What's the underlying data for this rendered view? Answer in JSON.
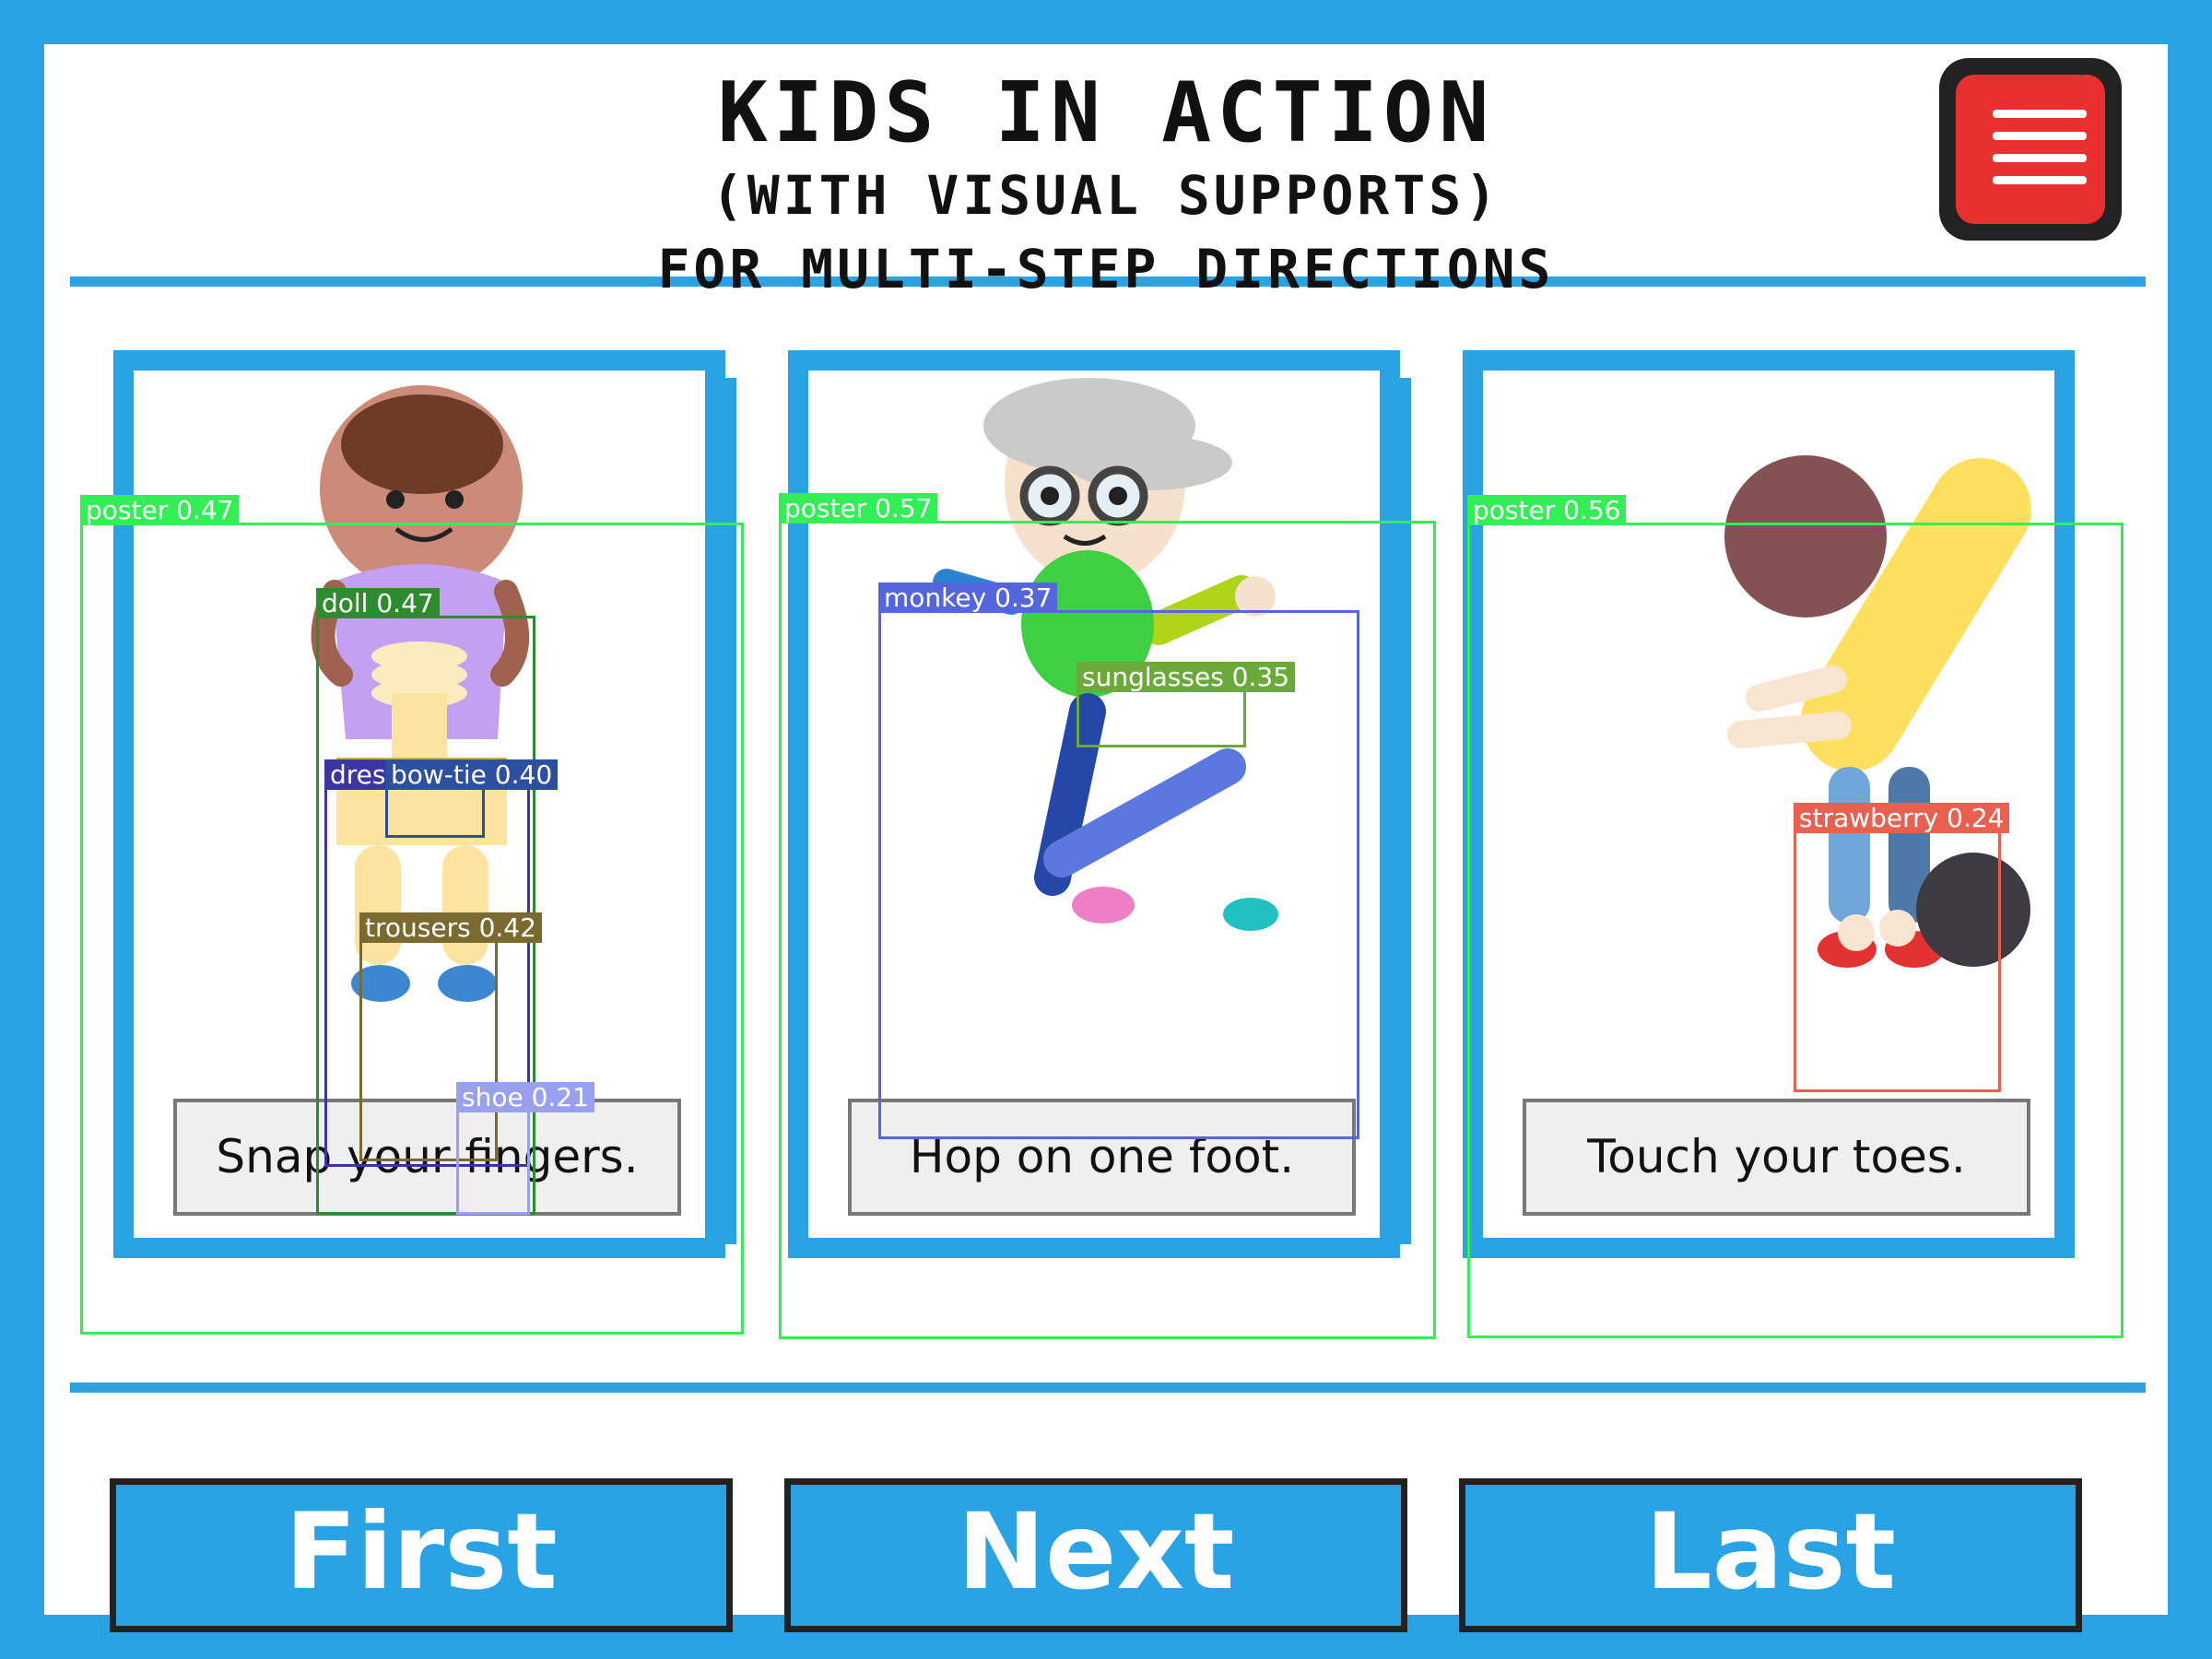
{
  "header": {
    "title": "KIDS IN ACTION",
    "subtitle": "(WITH VISUAL SUPPORTS)",
    "subtitle2": "FOR MULTI-STEP DIRECTIONS"
  },
  "menu": {
    "icon": "menu-icon",
    "color": "#e83030"
  },
  "cards": [
    {
      "caption": "Snap your fingers."
    },
    {
      "caption": "Hop on one foot."
    },
    {
      "caption": "Touch your toes."
    }
  ],
  "nav": {
    "first": "First",
    "next": "Next",
    "last": "Last"
  },
  "detections": [
    {
      "label": "poster 0.47"
    },
    {
      "label": "doll 0.47"
    },
    {
      "label": "dress_suit 0.40"
    },
    {
      "label": "bow-tie 0.40"
    },
    {
      "label": "trousers 0.42"
    },
    {
      "label": "shoe 0.21"
    },
    {
      "label": "poster 0.57"
    },
    {
      "label": "monkey 0.37"
    },
    {
      "label": "sunglasses 0.35"
    },
    {
      "label": "poster 0.56"
    },
    {
      "label": "strawberry 0.24"
    }
  ],
  "colors": {
    "accent": "#29a3e3",
    "background": "#ffffff"
  }
}
